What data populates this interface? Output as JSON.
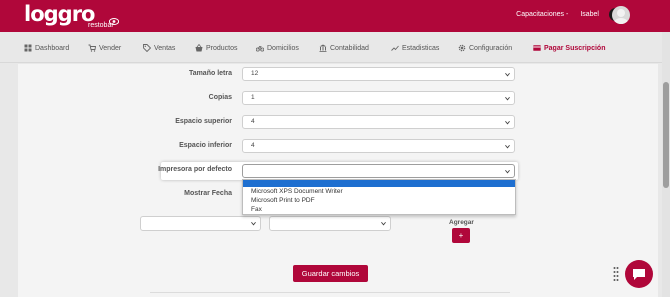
{
  "header": {
    "logo_text": "loggro",
    "logo_subtext": "restobar",
    "menu_label": "Capacitaciones -",
    "user_name": "Isabel",
    "notification_count": "0"
  },
  "nav": {
    "items": [
      {
        "label": "Dashboard",
        "icon": "dashboard-icon"
      },
      {
        "label": "Vender",
        "icon": "cart-icon"
      },
      {
        "label": "Ventas",
        "icon": "tag-icon"
      },
      {
        "label": "Productos",
        "icon": "basket-icon"
      },
      {
        "label": "Domicilios",
        "icon": "bike-icon"
      },
      {
        "label": "Contabilidad",
        "icon": "bank-icon"
      },
      {
        "label": "Estadisticas",
        "icon": "chart-icon"
      },
      {
        "label": "Configuración",
        "icon": "gear-icon"
      },
      {
        "label": "Pagar Suscripción",
        "icon": "card-icon"
      }
    ],
    "active_index": 8
  },
  "form": {
    "tamano_letra": {
      "label": "Tamaño letra",
      "value": "12"
    },
    "copias": {
      "label": "Copias",
      "value": "1"
    },
    "espacio_superior": {
      "label": "Espacio superior",
      "value": "4"
    },
    "espacio_inferior": {
      "label": "Espacio inferior",
      "value": "4"
    },
    "impresora": {
      "label": "Impresora por defecto",
      "value": "",
      "options": [
        "Microsoft XPS Document Writer",
        "Microsoft Print to PDF",
        "Fax"
      ]
    },
    "mostrar_fecha": {
      "label": "Mostrar Fecha"
    },
    "agregar_label": "Agregar",
    "add_button_label": "+",
    "save_button_label": "Guardar cambios"
  },
  "colors": {
    "brand": "#b0073a",
    "selected_option": "#1e6fd0"
  }
}
